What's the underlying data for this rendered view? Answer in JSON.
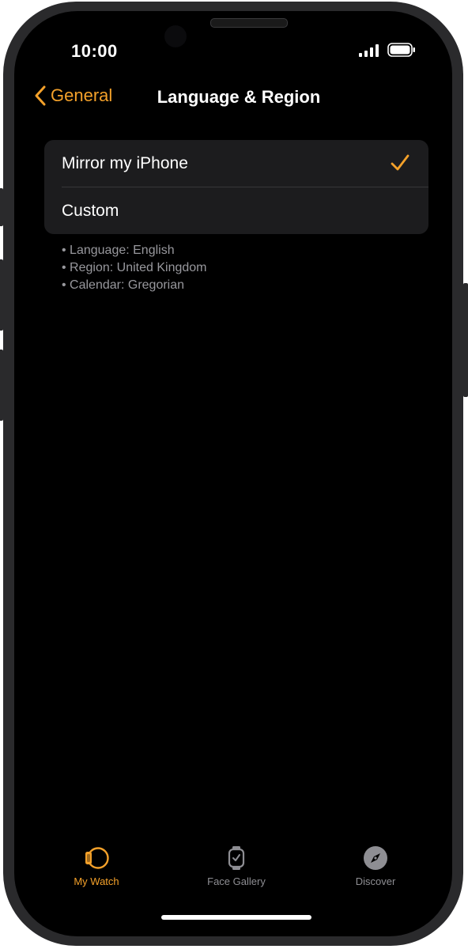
{
  "status_bar": {
    "time": "10:00",
    "signal_icon": "cellular-signal-icon",
    "battery_icon": "battery-icon"
  },
  "nav": {
    "back_label": "General",
    "title": "Language & Region"
  },
  "options": [
    {
      "label": "Mirror my iPhone",
      "selected": true
    },
    {
      "label": "Custom",
      "selected": false
    }
  ],
  "details": [
    "• Language: English",
    "• Region: United Kingdom",
    "• Calendar: Gregorian"
  ],
  "tabs": [
    {
      "label": "My Watch",
      "icon": "watch-icon",
      "active": true
    },
    {
      "label": "Face Gallery",
      "icon": "face-gallery-icon",
      "active": false
    },
    {
      "label": "Discover",
      "icon": "compass-icon",
      "active": false
    }
  ],
  "colors": {
    "accent": "#f4a12a",
    "background": "#000000",
    "group_background": "#1c1c1e",
    "secondary_text": "#98989d",
    "inactive_tab": "#8e8e93"
  }
}
